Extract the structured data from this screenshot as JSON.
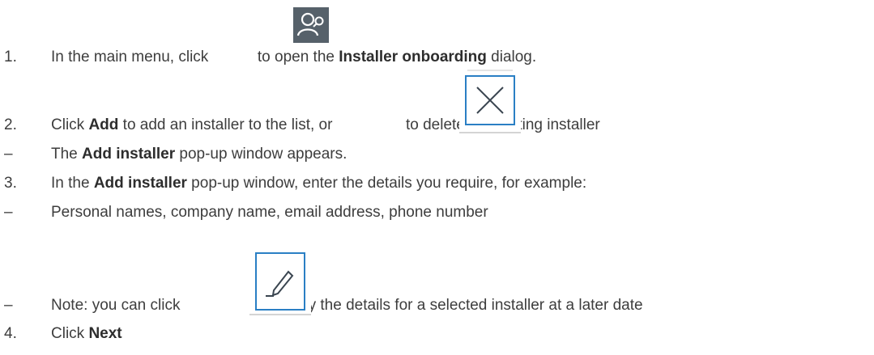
{
  "steps": [
    {
      "marker": "1.",
      "parts": [
        {
          "t": "In the main menu, click ",
          "b": false
        },
        {
          "icon": "installer-onboarding-icon"
        },
        {
          "t": " to open the ",
          "b": false
        },
        {
          "t": "Installer onboarding",
          "b": true
        },
        {
          "t": " dialog.",
          "b": false
        }
      ]
    },
    {
      "marker": "2.",
      "parts": [
        {
          "t": "Click ",
          "b": false
        },
        {
          "t": "Add",
          "b": true
        },
        {
          "t": " to add an installer to the list, or ",
          "b": false
        },
        {
          "icon": "close-icon"
        },
        {
          "t": " to delete an existing installer",
          "b": false
        }
      ]
    },
    {
      "marker": "–",
      "parts": [
        {
          "t": "The ",
          "b": false
        },
        {
          "t": "Add installer",
          "b": true
        },
        {
          "t": " pop-up window appears.",
          "b": false
        }
      ]
    },
    {
      "marker": "3.",
      "parts": [
        {
          "t": "In the ",
          "b": false
        },
        {
          "t": "Add installer",
          "b": true
        },
        {
          "t": " pop-up window, enter the details you require, for example:",
          "b": false
        }
      ]
    },
    {
      "marker": "–",
      "parts": [
        {
          "t": "Personal names, company name, email address, phone number",
          "b": false
        }
      ]
    },
    {
      "marker": "–",
      "parts": [
        {
          "t": "Note: you can click ",
          "b": false
        },
        {
          "icon": "pencil-edit-icon"
        },
        {
          "t": " to modify the details for a selected installer at a later date",
          "b": false
        }
      ]
    },
    {
      "marker": "4.",
      "parts": [
        {
          "t": "Click ",
          "b": false
        },
        {
          "t": "Next",
          "b": true
        }
      ]
    }
  ]
}
